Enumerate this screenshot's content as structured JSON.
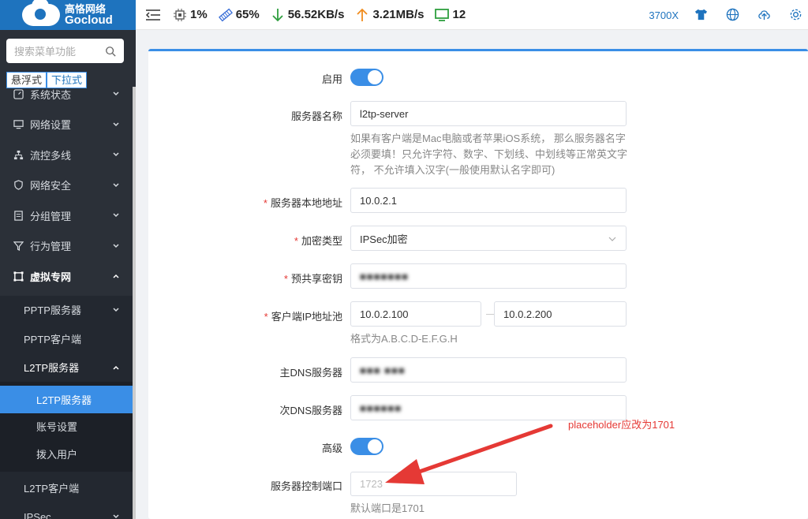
{
  "logo": {
    "cn": "高恪网络",
    "en": "Gocloud"
  },
  "search": {
    "placeholder": "搜索菜单功能"
  },
  "menu_mode": {
    "float": "悬浮式",
    "dropdown": "下拉式"
  },
  "menu": {
    "items": [
      {
        "label": "系统状态"
      },
      {
        "label": "网络设置"
      },
      {
        "label": "流控多线"
      },
      {
        "label": "网络安全"
      },
      {
        "label": "分组管理"
      },
      {
        "label": "行为管理"
      },
      {
        "label": "虚拟专网"
      }
    ],
    "vpn_sub": [
      {
        "label": "PPTP服务器"
      },
      {
        "label": "PPTP客户端"
      },
      {
        "label": "L2TP服务器"
      }
    ],
    "l2tp_sub": [
      {
        "label": "L2TP服务器"
      },
      {
        "label": "账号设置"
      },
      {
        "label": "拨入用户"
      }
    ],
    "vpn_sub_more": [
      {
        "label": "L2TP客户端"
      },
      {
        "label": "IPSec"
      }
    ]
  },
  "topbar": {
    "cpu": "1%",
    "mem": "65%",
    "down": "56.52KB/s",
    "up": "3.21MB/s",
    "online": "12",
    "model": "3700X",
    "colors": {
      "down": "#2e9e3e",
      "up": "#f08c1e",
      "online": "#2e9e3e",
      "accent": "#1e73be"
    }
  },
  "form": {
    "enable_label": "启用",
    "server_name_label": "服务器名称",
    "server_name_value": "l2tp-server",
    "server_name_hint": "如果有客户端是Mac电脑或者苹果iOS系统， 那么服务器名字必须要填！只允许字符、数字、下划线、中划线等正常英文字符， 不允许填入汉字(一般使用默认名字即可)",
    "local_addr_label": "服务器本地地址",
    "local_addr_value": "10.0.2.1",
    "encrypt_label": "加密类型",
    "encrypt_value": "IPSec加密",
    "psk_label": "预共享密钥",
    "psk_value": "■■■■■■■",
    "pool_label": "客户端IP地址池",
    "pool_start": "10.0.2.100",
    "pool_end": "10.0.2.200",
    "pool_hint": "格式为A.B.C.D-E.F.G.H",
    "dns1_label": "主DNS服务器",
    "dns1_value": "■■■ ■■■",
    "dns2_label": "次DNS服务器",
    "dns2_value": "■■■■■■",
    "advanced_label": "高级",
    "port_label": "服务器控制端口",
    "port_placeholder": "1723",
    "port_hint": "默认端口是1701"
  },
  "annotation": {
    "text": "placeholder应改为1701",
    "color": "#e53935"
  }
}
